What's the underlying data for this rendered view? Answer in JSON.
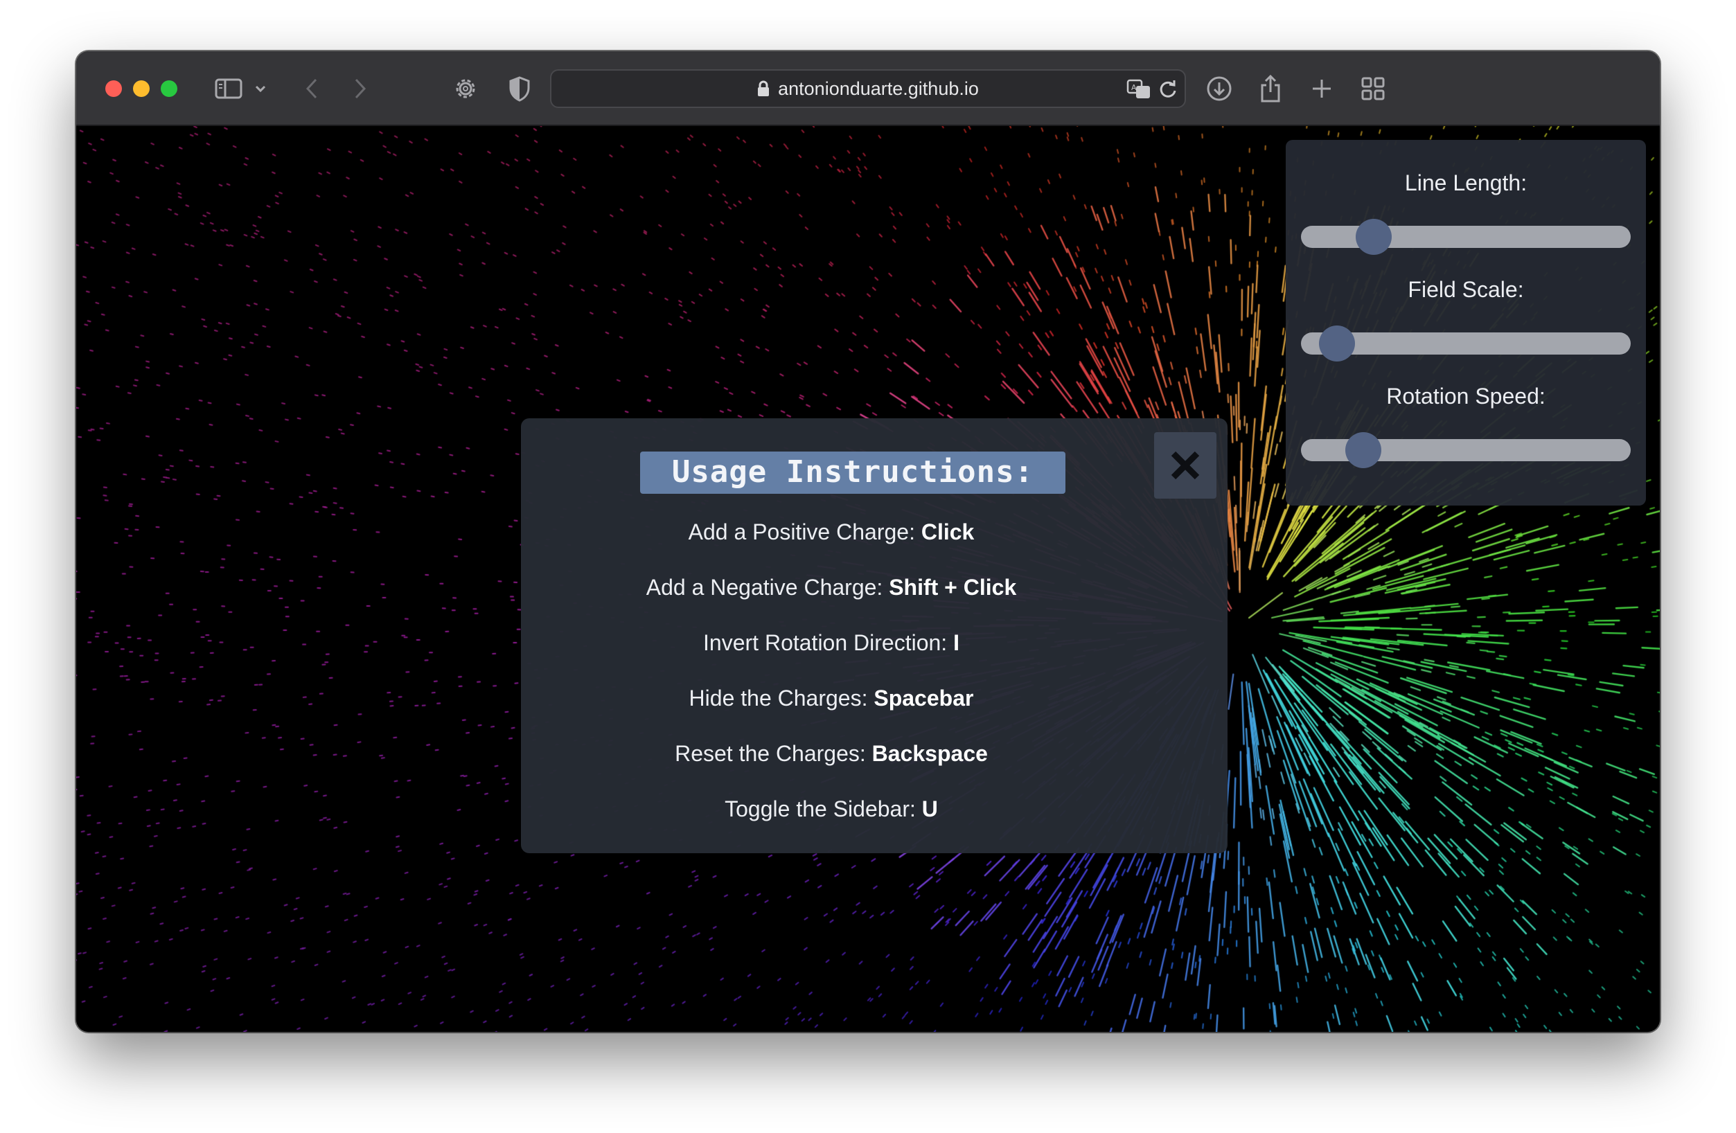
{
  "browser": {
    "url": "antonionduarte.github.io"
  },
  "sidebar": {
    "controls": [
      {
        "label": "Line Length:",
        "value": 0.22
      },
      {
        "label": "Field Scale:",
        "value": 0.11
      },
      {
        "label": "Rotation Speed:",
        "value": 0.19
      }
    ]
  },
  "modal": {
    "title": "Usage Instructions:",
    "close_label": "✕",
    "instructions": [
      {
        "text": "Add a Positive Charge: ",
        "key": "Click"
      },
      {
        "text": "Add a Negative Charge: ",
        "key": "Shift + Click"
      },
      {
        "text": "Invert Rotation Direction: ",
        "key": "I"
      },
      {
        "text": "Hide the Charges: ",
        "key": "Spacebar"
      },
      {
        "text": "Reset the Charges: ",
        "key": "Backspace"
      },
      {
        "text": "Toggle the Sidebar: ",
        "key": "U"
      }
    ]
  },
  "colors": {
    "accent": "#647fa6",
    "thumb": "#536384",
    "panel": "#262b34"
  },
  "icons": [
    "sidebar-icon",
    "chevron-down-icon",
    "back-icon",
    "forward-icon",
    "gear-icon",
    "shield-icon",
    "lock-icon",
    "translate-icon",
    "reload-icon",
    "download-icon",
    "share-icon",
    "plus-icon",
    "tabs-grid-icon",
    "close-icon"
  ]
}
